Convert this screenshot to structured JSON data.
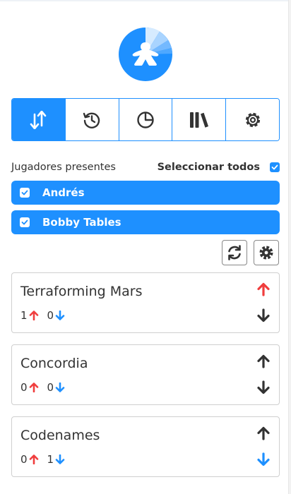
{
  "nav": {
    "tabs": [
      {
        "name": "sort",
        "icon": "sort-arrows-icon",
        "active": true
      },
      {
        "name": "history",
        "icon": "history-icon",
        "active": false
      },
      {
        "name": "stats",
        "icon": "pie-chart-icon",
        "active": false
      },
      {
        "name": "library",
        "icon": "books-icon",
        "active": false
      },
      {
        "name": "settings",
        "icon": "gear-icon",
        "active": false
      }
    ]
  },
  "players": {
    "title": "Jugadores presentes",
    "select_all_label": "Seleccionar todos",
    "select_all_checked": true,
    "list": [
      {
        "name": "Andrés",
        "checked": true
      },
      {
        "name": "Bobby Tables",
        "checked": true
      }
    ]
  },
  "tools": {
    "refresh_icon": "refresh-icon",
    "settings_icon": "gear-icon"
  },
  "games": [
    {
      "name": "Terraforming Mars",
      "up_count": "1",
      "down_count": "0",
      "up_active": true,
      "down_active": false
    },
    {
      "name": "Concordia",
      "up_count": "0",
      "down_count": "0",
      "up_active": false,
      "down_active": false
    },
    {
      "name": "Codenames",
      "up_count": "0",
      "down_count": "1",
      "up_active": false,
      "down_active": true
    }
  ],
  "colors": {
    "primary": "#1e90ff",
    "up_arrow": "#f03e3e",
    "down_arrow": "#1e90ff",
    "dark": "#333333"
  }
}
